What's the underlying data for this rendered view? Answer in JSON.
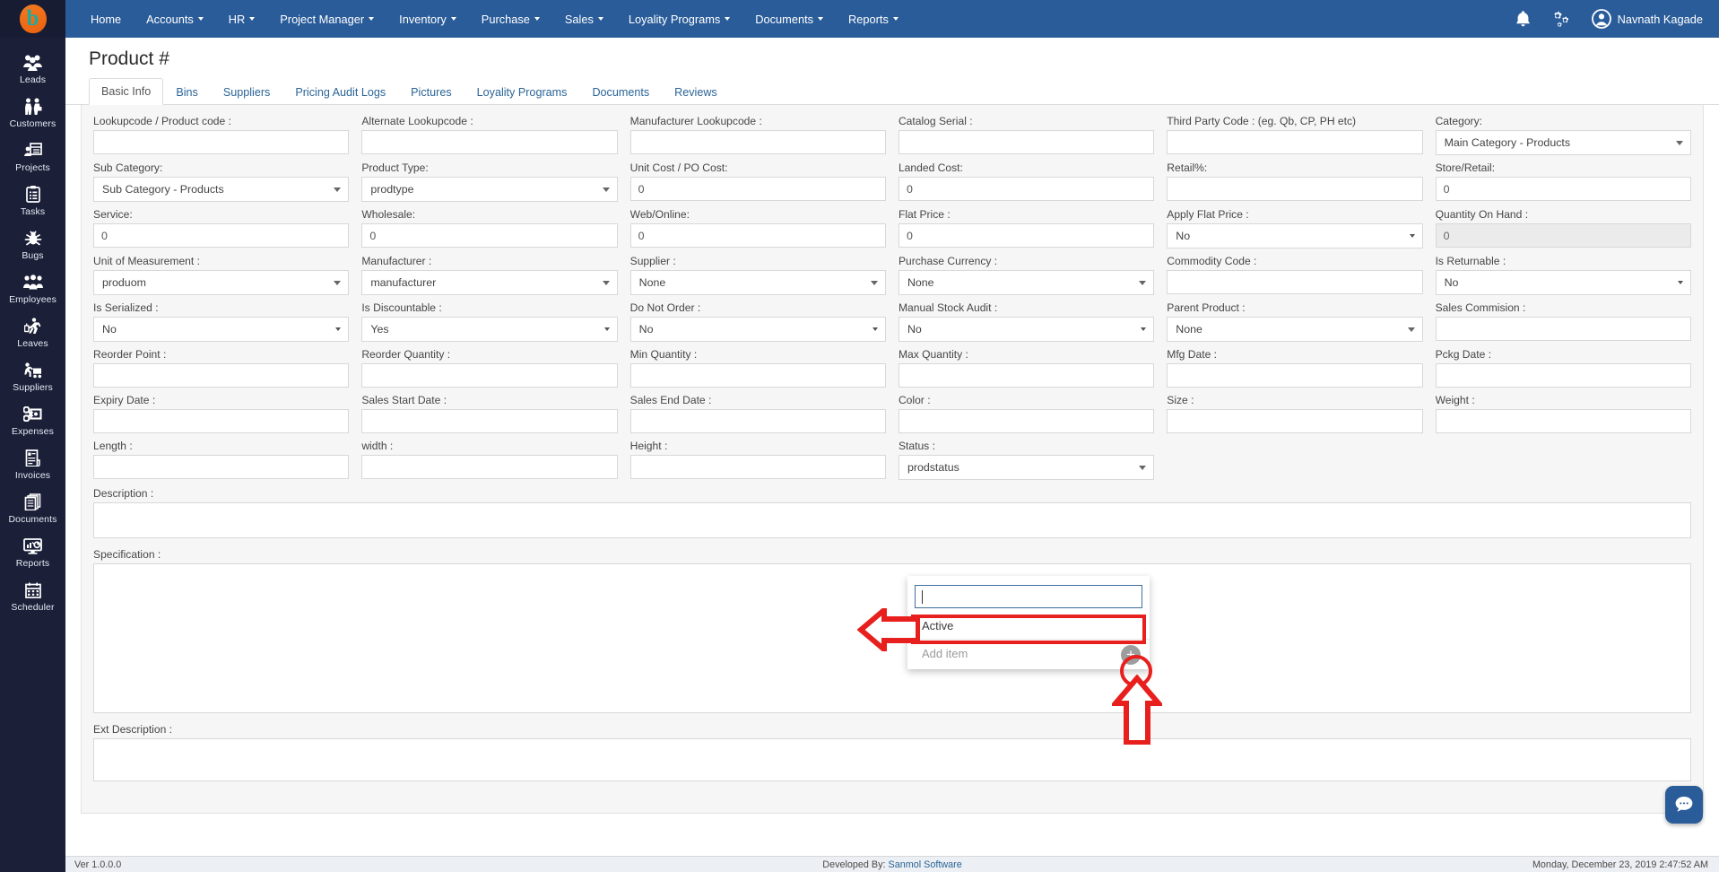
{
  "brand": {
    "logo_letter": "b"
  },
  "topnav": {
    "items": [
      {
        "label": "Home",
        "caret": false
      },
      {
        "label": "Accounts",
        "caret": true
      },
      {
        "label": "HR",
        "caret": true
      },
      {
        "label": "Project Manager",
        "caret": true
      },
      {
        "label": "Inventory",
        "caret": true
      },
      {
        "label": "Purchase",
        "caret": true
      },
      {
        "label": "Sales",
        "caret": true
      },
      {
        "label": "Loyality Programs",
        "caret": true
      },
      {
        "label": "Documents",
        "caret": true
      },
      {
        "label": "Reports",
        "caret": true
      }
    ],
    "bell_icon": "bell-icon",
    "settings_icon": "gears-icon",
    "user_name": "Navnath Kagade"
  },
  "sidebar": {
    "items": [
      {
        "label": "Leads",
        "icon": "leads-icon"
      },
      {
        "label": "Customers",
        "icon": "customers-icon"
      },
      {
        "label": "Projects",
        "icon": "projects-icon"
      },
      {
        "label": "Tasks",
        "icon": "tasks-clipboard-icon"
      },
      {
        "label": "Bugs",
        "icon": "bug-icon"
      },
      {
        "label": "Employees",
        "icon": "employees-icon"
      },
      {
        "label": "Leaves",
        "icon": "leaves-walking-icon"
      },
      {
        "label": "Suppliers",
        "icon": "suppliers-trolley-icon"
      },
      {
        "label": "Expenses",
        "icon": "expenses-scissors-icon"
      },
      {
        "label": "Invoices",
        "icon": "invoice-icon"
      },
      {
        "label": "Documents",
        "icon": "documents-icon"
      },
      {
        "label": "Reports",
        "icon": "reports-monitor-icon"
      },
      {
        "label": "Scheduler",
        "icon": "calendar-icon"
      }
    ]
  },
  "page": {
    "title": "Product #",
    "tabs": [
      {
        "label": "Basic Info",
        "active": true
      },
      {
        "label": "Bins",
        "active": false
      },
      {
        "label": "Suppliers",
        "active": false
      },
      {
        "label": "Pricing Audit Logs",
        "active": false
      },
      {
        "label": "Pictures",
        "active": false
      },
      {
        "label": "Loyality Programs",
        "active": false
      },
      {
        "label": "Documents",
        "active": false
      },
      {
        "label": "Reviews",
        "active": false
      }
    ]
  },
  "form": {
    "rows": [
      [
        {
          "label": "Lookupcode / Product code :",
          "type": "text",
          "value": ""
        },
        {
          "label": "Alternate Lookupcode :",
          "type": "text",
          "value": ""
        },
        {
          "label": "Manufacturer Lookupcode :",
          "type": "text",
          "value": ""
        },
        {
          "label": "Catalog Serial :",
          "type": "text",
          "value": ""
        },
        {
          "label": "Third Party Code : (eg. Qb, CP, PH etc)",
          "type": "text",
          "value": ""
        },
        {
          "label": "Category:",
          "type": "select",
          "value": "Main Category - Products"
        }
      ],
      [
        {
          "label": "Sub Category:",
          "type": "select",
          "value": "Sub Category - Products"
        },
        {
          "label": "Product Type:",
          "type": "select",
          "value": "prodtype"
        },
        {
          "label": "Unit Cost / PO Cost:",
          "type": "text",
          "value": "0"
        },
        {
          "label": "Landed Cost:",
          "type": "text",
          "value": "0"
        },
        {
          "label": "Retail%:",
          "type": "text",
          "value": ""
        },
        {
          "label": "Store/Retail:",
          "type": "text",
          "value": "0"
        }
      ],
      [
        {
          "label": "Service:",
          "type": "text",
          "value": "0"
        },
        {
          "label": "Wholesale:",
          "type": "text",
          "value": "0"
        },
        {
          "label": "Web/Online:",
          "type": "text",
          "value": "0"
        },
        {
          "label": "Flat Price :",
          "type": "text",
          "value": "0"
        },
        {
          "label": "Apply Flat Price :",
          "type": "select-narrow",
          "value": "No"
        },
        {
          "label": "Quantity On Hand :",
          "type": "readonly",
          "value": "0"
        }
      ],
      [
        {
          "label": "Unit of Measurement :",
          "type": "select",
          "value": "produom"
        },
        {
          "label": "Manufacturer :",
          "type": "select",
          "value": "manufacturer"
        },
        {
          "label": "Supplier :",
          "type": "select",
          "value": "None"
        },
        {
          "label": "Purchase Currency :",
          "type": "select",
          "value": "None"
        },
        {
          "label": "Commodity Code :",
          "type": "text",
          "value": ""
        },
        {
          "label": "Is Returnable :",
          "type": "select-narrow",
          "value": "No"
        }
      ],
      [
        {
          "label": "Is Serialized :",
          "type": "select-narrow",
          "value": "No"
        },
        {
          "label": "Is Discountable :",
          "type": "select-narrow",
          "value": "Yes"
        },
        {
          "label": "Do Not Order :",
          "type": "select-narrow",
          "value": "No"
        },
        {
          "label": "Manual Stock Audit :",
          "type": "select-narrow",
          "value": "No"
        },
        {
          "label": "Parent Product :",
          "type": "select",
          "value": "None"
        },
        {
          "label": "Sales Commision :",
          "type": "text",
          "value": ""
        }
      ],
      [
        {
          "label": "Reorder Point :",
          "type": "text",
          "value": ""
        },
        {
          "label": "Reorder Quantity :",
          "type": "text",
          "value": ""
        },
        {
          "label": "Min Quantity :",
          "type": "text",
          "value": ""
        },
        {
          "label": "Max Quantity :",
          "type": "text",
          "value": ""
        },
        {
          "label": "Mfg Date :",
          "type": "text",
          "value": ""
        },
        {
          "label": "Pckg Date :",
          "type": "text",
          "value": ""
        }
      ],
      [
        {
          "label": "Expiry Date :",
          "type": "text",
          "value": ""
        },
        {
          "label": "Sales Start Date :",
          "type": "text",
          "value": ""
        },
        {
          "label": "Sales End Date :",
          "type": "text",
          "value": ""
        },
        {
          "label": "Color :",
          "type": "text",
          "value": ""
        },
        {
          "label": "Size :",
          "type": "text",
          "value": ""
        },
        {
          "label": "Weight :",
          "type": "text",
          "value": ""
        }
      ],
      [
        {
          "label": "Length :",
          "type": "text",
          "value": ""
        },
        {
          "label": "width :",
          "type": "text",
          "value": ""
        },
        {
          "label": "Height :",
          "type": "text",
          "value": ""
        },
        {
          "label": "Status :",
          "type": "select",
          "value": "prodstatus"
        },
        {
          "label": "",
          "type": "blank",
          "value": ""
        },
        {
          "label": "",
          "type": "blank",
          "value": ""
        }
      ]
    ],
    "description_label": "Description :",
    "description_value": "",
    "specification_label": "Specification :",
    "specification_value": "",
    "ext_description_label": "Ext Description :",
    "ext_description_value": ""
  },
  "status_dropdown": {
    "search_value": "",
    "options": [
      "Active"
    ],
    "add_item_label": "Add item",
    "plus_icon": "plus-circle-icon",
    "highlight_color": "#e8201d"
  },
  "chat": {
    "icon": "chat-bubble-icon",
    "color": "#2a5c9a"
  },
  "footer": {
    "version": "Ver 1.0.0.0",
    "developed_by_prefix": "Developed By:",
    "developed_by_link": "Sanmol Software",
    "datetime": "Monday, December 23, 2019 2:47:52 AM"
  }
}
